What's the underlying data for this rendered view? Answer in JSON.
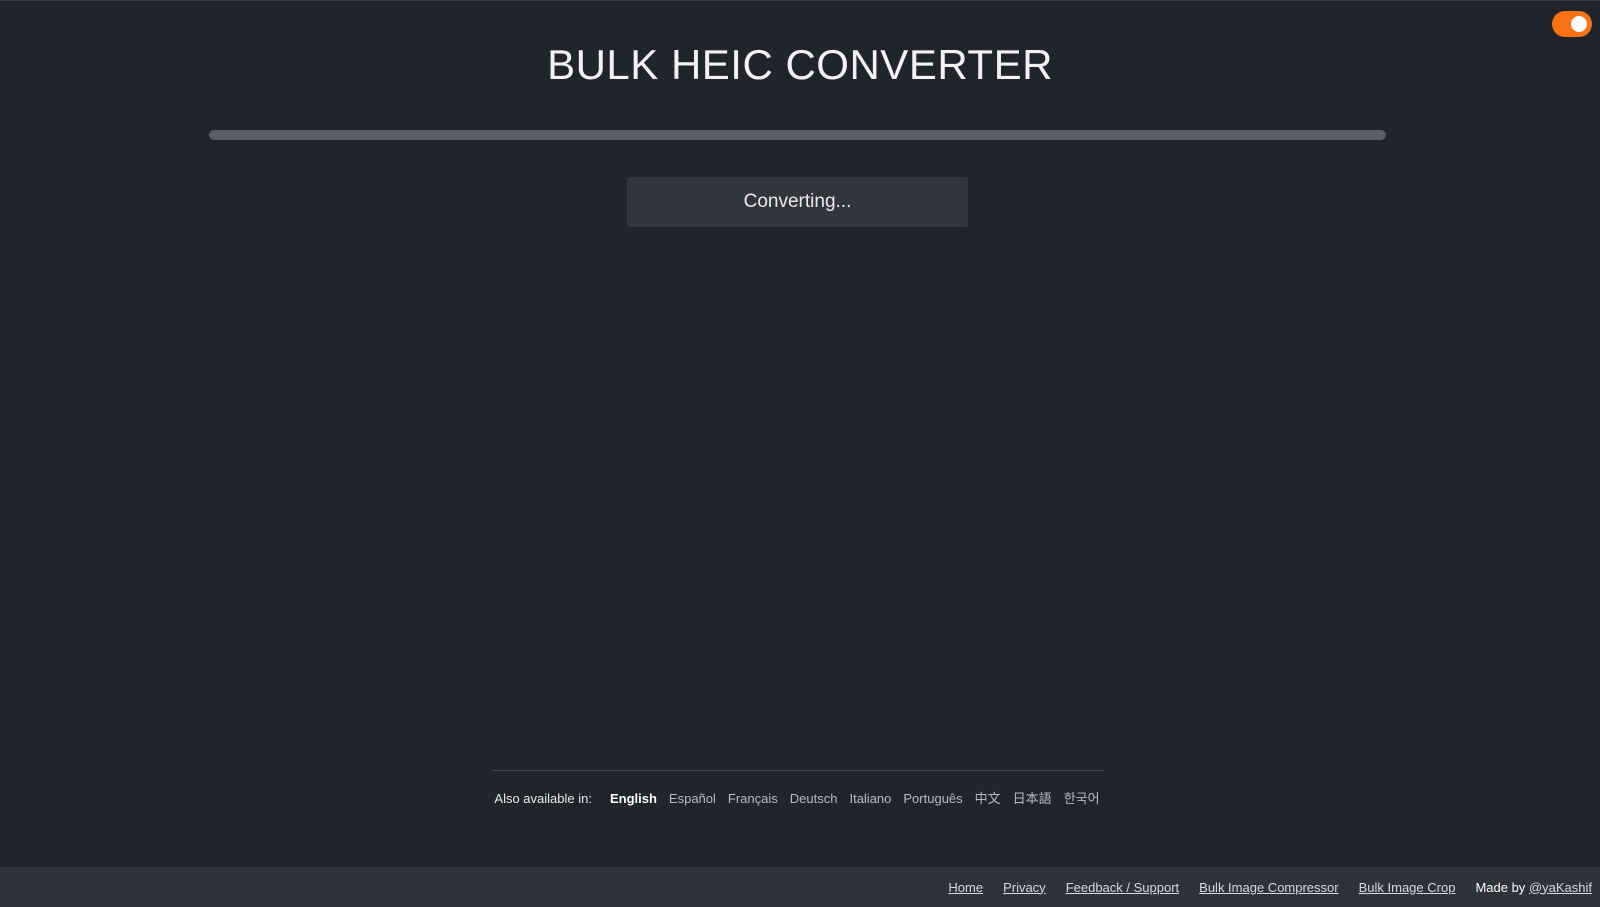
{
  "header": {
    "title": "BULK HEIC CONVERTER"
  },
  "theme_toggle": {
    "state": "on",
    "accent_color": "#f97316"
  },
  "progress": {
    "value": 1.0
  },
  "status": {
    "text": "Converting..."
  },
  "languages": {
    "label": "Also available in:",
    "items": [
      {
        "label": "English",
        "active": true
      },
      {
        "label": "Español",
        "active": false
      },
      {
        "label": "Français",
        "active": false
      },
      {
        "label": "Deutsch",
        "active": false
      },
      {
        "label": "Italiano",
        "active": false
      },
      {
        "label": "Português",
        "active": false
      },
      {
        "label": "中文",
        "active": false
      },
      {
        "label": "日本語",
        "active": false
      },
      {
        "label": "한국어",
        "active": false
      }
    ]
  },
  "footer": {
    "links": [
      {
        "label": "Home"
      },
      {
        "label": "Privacy"
      },
      {
        "label": "Feedback / Support"
      },
      {
        "label": "Bulk Image Compressor"
      },
      {
        "label": "Bulk Image Crop"
      }
    ],
    "made_by_prefix": "Made by",
    "made_by_handle": "@yaKashif"
  },
  "colors": {
    "background": "#22242b",
    "footer_background": "#30323a",
    "status_box": "#33353c"
  }
}
